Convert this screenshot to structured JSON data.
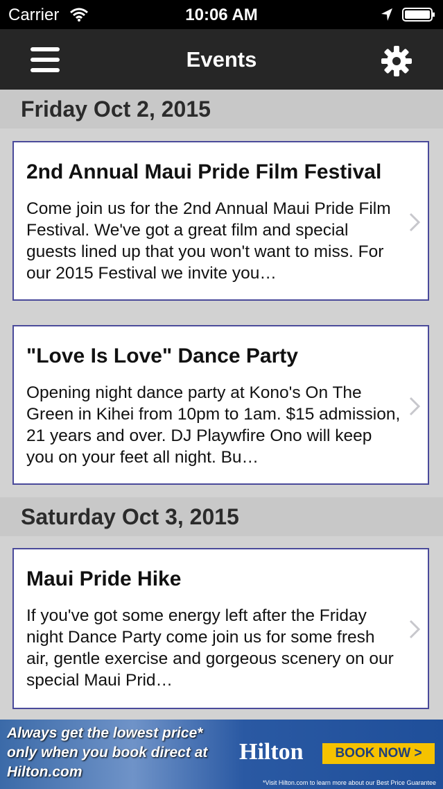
{
  "status_bar": {
    "carrier": "Carrier",
    "time": "10:06 AM"
  },
  "nav": {
    "title": "Events"
  },
  "sections": [
    {
      "header": "Friday Oct 2, 2015",
      "events": [
        {
          "title": "2nd Annual Maui Pride Film Festival",
          "description": "Come join us for the 2nd Annual Maui Pride Film Festival. We've got a great film and special guests lined up that you won't want to miss. For our 2015 Festival we invite you…"
        },
        {
          "title": "\"Love Is Love\" Dance Party",
          "description": "Opening night dance party at Kono's On The Green in Kihei from 10pm to 1am. $15 admission, 21 years and over. DJ Playwfire Ono will keep you on your feet all night. Bu…"
        }
      ]
    },
    {
      "header": "Saturday Oct 3, 2015",
      "events": [
        {
          "title": "Maui Pride Hike",
          "description": "If you've got some energy left after the Friday night Dance Party come join us for some fresh air, gentle exercise and gorgeous scenery on our special Maui Prid…"
        }
      ]
    }
  ],
  "ad": {
    "headline": "Always get the lowest price* only when you book direct at Hilton.com",
    "brand": "Hilton",
    "cta": "BOOK NOW >",
    "fine_print": "*Visit Hilton.com to learn more about our Best Price Guarantee"
  }
}
